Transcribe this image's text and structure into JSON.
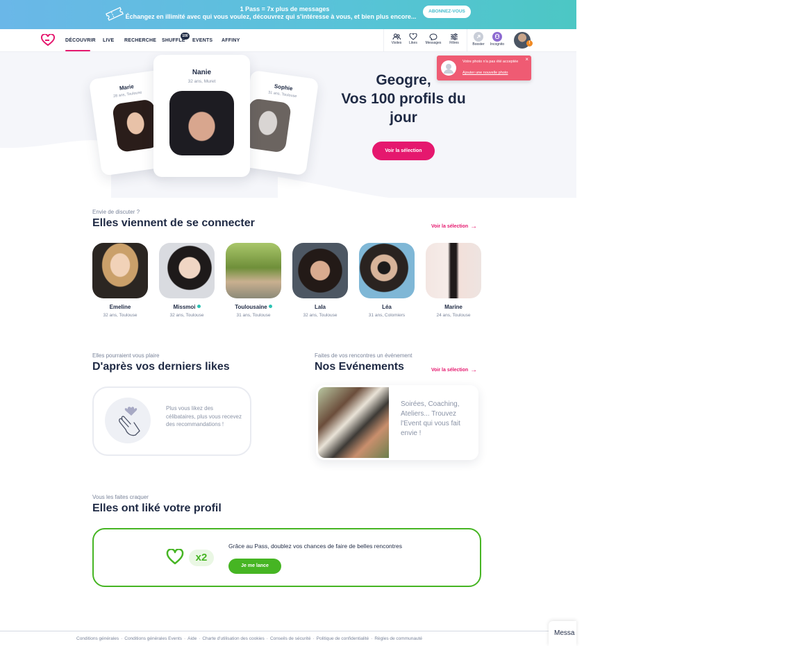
{
  "promo": {
    "line1": "1 Pass = 7x plus de messages",
    "line2": "Échangez en illimité avec qui vous voulez, découvrez qui s'intéresse à vous, et bien plus encore...",
    "cta": "ABONNEZ-VOUS",
    "icon": "ticket-icon"
  },
  "nav": {
    "links": [
      "DÉCOUVRIR",
      "LIVE",
      "RECHERCHE",
      "SHUFFLE",
      "EVENTS",
      "AFFINY"
    ],
    "shuffle_badge": "100",
    "icons": [
      {
        "label": "Visites",
        "icon": "visits-icon"
      },
      {
        "label": "Likes",
        "icon": "heart-icon"
      },
      {
        "label": "Messages",
        "icon": "message-icon"
      },
      {
        "label": "Filtres",
        "icon": "filters-icon"
      },
      {
        "label": "Booster",
        "icon": "booster-icon"
      },
      {
        "label": "Incognito",
        "icon": "incognito-icon"
      }
    ],
    "avatar_badge": "!",
    "accent": "#e5186e"
  },
  "toast": {
    "message": "Votre photo n'a pas été acceptée",
    "link": "Ajouter une nouvelle photo",
    "close": "×",
    "color": "#ef5b73"
  },
  "hero": {
    "cards": [
      {
        "name": "Marie",
        "info": "28 ans, Toulouse"
      },
      {
        "name": "Nanie",
        "info": "32 ans, Muret"
      },
      {
        "name": "Sophie",
        "info": "31 ans, Toulouse"
      }
    ],
    "title_line1": "Geogre,",
    "title_line2": "Vos 100 profils du jour",
    "button": "Voir la sélection"
  },
  "connected": {
    "kicker": "Envie de discuter ?",
    "title": "Elles viennent de se connecter",
    "see_all": "Voir la sélection",
    "profiles": [
      {
        "name": "Emeline",
        "info": "32 ans, Toulouse",
        "online": false
      },
      {
        "name": "Missmoi",
        "info": "32 ans, Toulouse",
        "online": true
      },
      {
        "name": "Toulousaine",
        "info": "31 ans, Toulouse",
        "online": true
      },
      {
        "name": "Lala",
        "info": "32 ans, Toulouse",
        "online": false
      },
      {
        "name": "Léa",
        "info": "31 ans, Colomiers",
        "online": false
      },
      {
        "name": "Marine",
        "info": "24 ans, Toulouse",
        "online": false
      }
    ]
  },
  "likes_section": {
    "kicker": "Elles pourraient vous plaire",
    "title": "D'après vos derniers likes",
    "text": "Plus vous likez des célibataires, plus vous recevez des recommandations !"
  },
  "events_section": {
    "kicker": "Faites de vos rencontres un événement",
    "title": "Nos Evénements",
    "see_all": "Voir la sélection",
    "text": "Soirées, Coaching, Ateliers... Trouvez l'Event qui vous fait envie !"
  },
  "liked_you": {
    "kicker": "Vous les faites craquer",
    "title": "Elles ont liké votre profil",
    "multiplier": "x2",
    "text": "Grâce au Pass, doublez vos chances de faire de belles rencontres",
    "button": "Je me lance",
    "color": "#46b523"
  },
  "footer": {
    "links": [
      "Conditions générales",
      "Conditions générales Events",
      "Aide",
      "Charte d'utilisation des cookies",
      "Conseils de sécurité",
      "Politique de confidentialité",
      "Règles de communauté"
    ]
  },
  "messages_tab": "Messa"
}
